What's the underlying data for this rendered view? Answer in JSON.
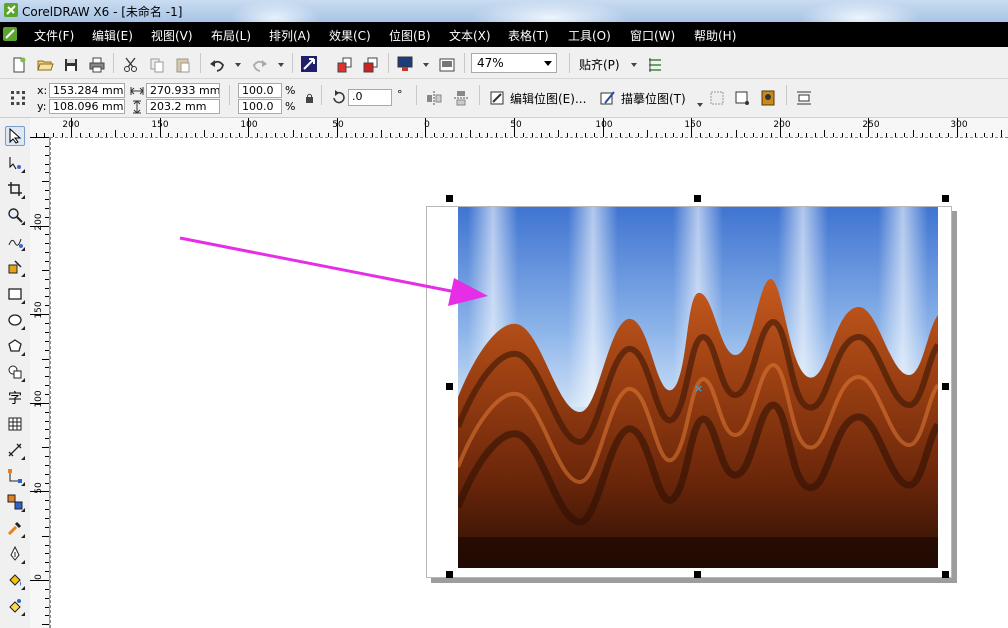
{
  "window": {
    "title": "CorelDRAW X6 - [未命名 -1]"
  },
  "menu": [
    {
      "label": "文件(F)"
    },
    {
      "label": "编辑(E)"
    },
    {
      "label": "视图(V)"
    },
    {
      "label": "布局(L)"
    },
    {
      "label": "排列(A)"
    },
    {
      "label": "效果(C)"
    },
    {
      "label": "位图(B)"
    },
    {
      "label": "文本(X)"
    },
    {
      "label": "表格(T)"
    },
    {
      "label": "工具(O)"
    },
    {
      "label": "窗口(W)"
    },
    {
      "label": "帮助(H)"
    }
  ],
  "toolbar": {
    "zoom": "47%",
    "snap_label": "贴齐(P)"
  },
  "property_bar": {
    "x_label": "x:",
    "y_label": "y:",
    "x_value": "153.284 mm",
    "y_value": "108.096 mm",
    "width_value": "270.933 mm",
    "height_value": "203.2 mm",
    "scale_x": "100.0",
    "scale_y": "100.0",
    "percent": "%",
    "rotation": ".0",
    "degree": "°",
    "edit_bitmap": "编辑位图(E)...",
    "trace_bitmap": "描摹位图(T)"
  },
  "ruler_h": [
    "200",
    "150",
    "100",
    "50",
    "0",
    "50",
    "100",
    "150",
    "200",
    "250",
    "300"
  ],
  "ruler_v": [
    "200",
    "150",
    "100",
    "50",
    "0"
  ],
  "colors": {
    "menubar_bg": "#000000",
    "accent_arrow": "#e62ee6",
    "selection_handle": "#000000"
  }
}
